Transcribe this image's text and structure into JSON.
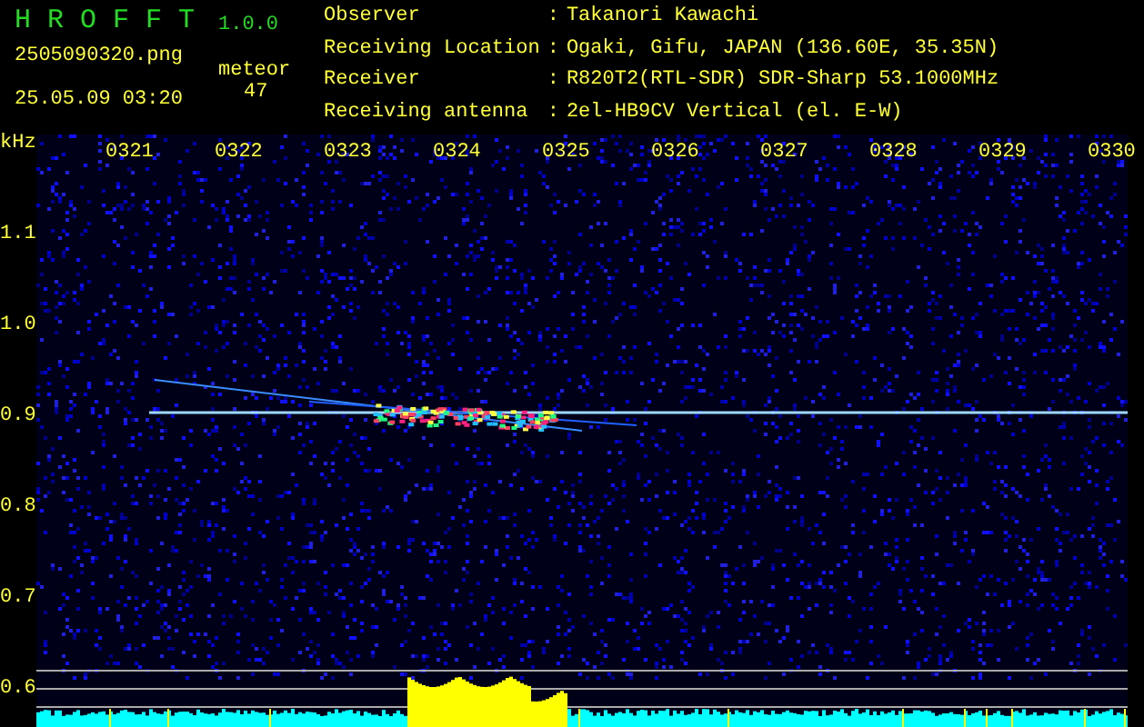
{
  "app": {
    "name": "H R O F F T",
    "version": "1.0.0"
  },
  "file": {
    "name": "2505090320.png",
    "timestamp": "25.05.09 03:20"
  },
  "meteor": {
    "label": "meteor",
    "count": "47"
  },
  "station": [
    {
      "label": "Observer",
      "separator": ":",
      "value": "Takanori Kawachi"
    },
    {
      "label": "Receiving Location",
      "separator": ":",
      "value": "Ogaki, Gifu, JAPAN (136.60E, 35.35N)"
    },
    {
      "label": "Receiver",
      "separator": ":",
      "value": "R820T2(RTL-SDR) SDR-Sharp 53.1000MHz"
    },
    {
      "label": "Receiving antenna",
      "separator": ":",
      "value": "2el-HB9CV Vertical (el. E-W)"
    }
  ],
  "plot": {
    "y_unit": "kHz",
    "x_labels": [
      "0321",
      "0322",
      "0323",
      "0324",
      "0325",
      "0326",
      "0327",
      "0328",
      "0329",
      "0330"
    ],
    "y_labels": [
      "1.1",
      "1.0",
      "0.9",
      "0.8",
      "0.7",
      "0.6"
    ]
  }
}
